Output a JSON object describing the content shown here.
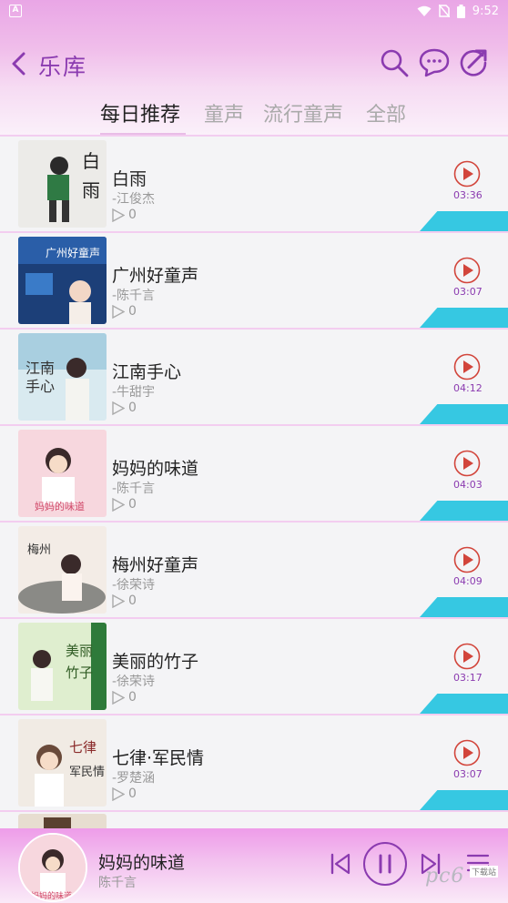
{
  "status_bar": {
    "left_icon": "A",
    "time": "9:52"
  },
  "header": {
    "title": "乐库",
    "icons": [
      "back-icon",
      "search-icon",
      "chat-icon",
      "share-icon"
    ]
  },
  "tabs": [
    {
      "label": "每日推荐",
      "active": true
    },
    {
      "label": "童声",
      "active": false
    },
    {
      "label": "流行童声",
      "active": false
    },
    {
      "label": "全部",
      "active": false
    }
  ],
  "songs": [
    {
      "title": "白雨",
      "artist": "-江俊杰",
      "plays": "0",
      "duration": "03:36"
    },
    {
      "title": "广州好童声",
      "artist": "-陈千言",
      "plays": "0",
      "duration": "03:07"
    },
    {
      "title": "江南手心",
      "artist": "-牛甜宇",
      "plays": "0",
      "duration": "04:12"
    },
    {
      "title": "妈妈的味道",
      "artist": "-陈千言",
      "plays": "0",
      "duration": "04:03"
    },
    {
      "title": "梅州好童声",
      "artist": "-徐荣诗",
      "plays": "0",
      "duration": "04:09"
    },
    {
      "title": "美丽的竹子",
      "artist": "-徐荣诗",
      "plays": "0",
      "duration": "03:17"
    },
    {
      "title": "七律·军民情",
      "artist": "-罗楚涵",
      "plays": "0",
      "duration": "03:07"
    }
  ],
  "now_playing": {
    "title": "妈妈的味道",
    "artist": "陈千言"
  },
  "watermark": {
    "text": "pc6",
    "sub": "下载站"
  },
  "colors": {
    "accent": "#8b3bb0",
    "play_red": "#d2453b",
    "teal": "#36c8e2",
    "header_pink": "#e9a6e6"
  }
}
